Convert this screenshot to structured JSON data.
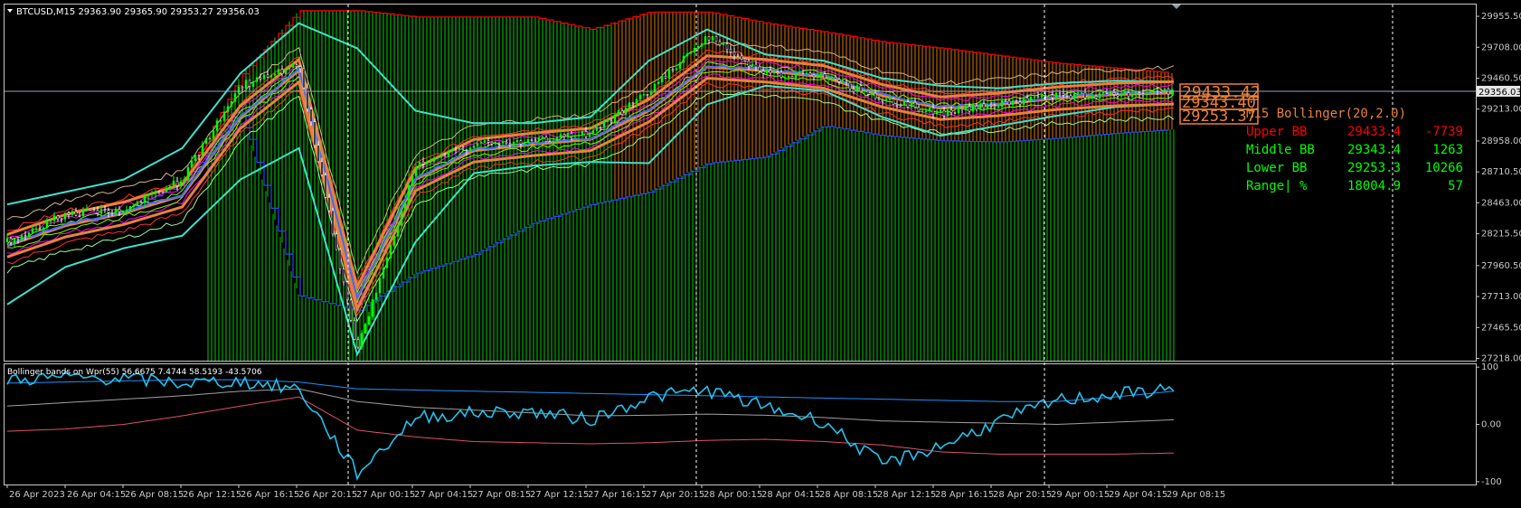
{
  "header": {
    "symbol_line": "BTCUSD,M15  29363.90 29365.90 29353.27 29356.03"
  },
  "current_price_label": "29356.03",
  "bb_panel": {
    "title": "M15 Bollinger(20,2.0)",
    "rows": [
      {
        "label": "Upper BB",
        "value": "29433.4",
        "extra": "-7739",
        "color": "#ff0000"
      },
      {
        "label": "Middle BB",
        "value": "29343.4",
        "extra": "1263",
        "color": "#00ff00"
      },
      {
        "label": "Lower BB",
        "value": "29253.3",
        "extra": "10266",
        "color": "#00ff00"
      },
      {
        "label": "Range| %",
        "value": "18004.9",
        "extra": "57",
        "color": "#00ff00"
      }
    ]
  },
  "price_tags": [
    "29433.42",
    "29343.40",
    "29253.37"
  ],
  "indicator_title": "Bollinger bands on Wpr(55) 56.6675 7.4744 58.5193 -43.5706",
  "colors": {
    "background": "#000000",
    "bull": "#00ff00",
    "bear": "#ff8c00",
    "cloud_edge": "#ff0000",
    "bb_orange": "#e8823a",
    "cyan": "#40e0d0",
    "wpr_line": "#22c3ee",
    "axis": "#c8c8c8"
  },
  "chart_data": [
    {
      "type": "line",
      "name": "price",
      "x": [
        "26 Apr 2023",
        "26 Apr 04:15",
        "26 Apr 08:15",
        "26 Apr 12:15",
        "26 Apr 16:15",
        "26 Apr 20:15",
        "27 Apr 00:15",
        "27 Apr 04:15",
        "27 Apr 08:15",
        "27 Apr 12:15",
        "27 Apr 16:15",
        "27 Apr 20:15",
        "28 Apr 00:15",
        "28 Apr 04:15",
        "28 Apr 08:15",
        "28 Apr 12:15",
        "28 Apr 16:15",
        "28 Apr 20:15",
        "29 Apr 00:15",
        "29 Apr 04:15",
        "29 Apr 08:15"
      ],
      "y_ticks": [
        29955.5,
        29708.0,
        29460.5,
        29213.0,
        28958.0,
        28710.5,
        28463.0,
        28215.5,
        27960.5,
        27713.0,
        27465.5,
        27218.0
      ],
      "ylim": [
        27200,
        30050
      ],
      "price_series": [
        28150,
        28380,
        28400,
        28650,
        29400,
        29560,
        27280,
        28750,
        28930,
        28950,
        29020,
        29350,
        29800,
        29500,
        29470,
        29300,
        29180,
        29250,
        29320,
        29330,
        29356
      ],
      "middle_bb": [
        28120,
        28280,
        28380,
        28520,
        29150,
        29520,
        27700,
        28650,
        28880,
        28930,
        28970,
        29200,
        29550,
        29520,
        29470,
        29320,
        29220,
        29250,
        29300,
        29330,
        29343
      ],
      "upper_bb": [
        28450,
        28550,
        28650,
        28900,
        29500,
        29900,
        29700,
        29200,
        29100,
        29100,
        29150,
        29600,
        29850,
        29650,
        29600,
        29460,
        29400,
        29380,
        29420,
        29440,
        29433
      ],
      "lower_bb": [
        27650,
        27950,
        28100,
        28200,
        28650,
        28900,
        27250,
        28150,
        28700,
        28760,
        28790,
        28780,
        29250,
        29400,
        29360,
        29150,
        29000,
        29080,
        29160,
        29230,
        29253
      ],
      "cloud_top": [
        28080,
        28250,
        28400,
        28620,
        29480,
        30000,
        30000,
        29950,
        29950,
        29950,
        29850,
        29990,
        29990,
        29900,
        29830,
        29750,
        29700,
        29640,
        29580,
        29540,
        29500
      ],
      "cloud_bottom": [
        28080,
        28250,
        28400,
        28620,
        29200,
        27720,
        27600,
        27900,
        28050,
        28300,
        28450,
        28550,
        28780,
        28830,
        29080,
        29000,
        28960,
        28950,
        28980,
        29020,
        29050
      ]
    },
    {
      "type": "line",
      "name": "wpr",
      "ylim": [
        -105,
        105
      ],
      "y_ticks": [
        100,
        0.0,
        -100
      ],
      "wpr": [
        78,
        82,
        80,
        72,
        75,
        62,
        -85,
        12,
        20,
        22,
        8,
        48,
        60,
        30,
        5,
        -70,
        -38,
        5,
        42,
        52,
        62
      ],
      "wpr_upper": [
        72,
        74,
        76,
        78,
        78,
        74,
        62,
        60,
        58,
        56,
        54,
        52,
        50,
        48,
        46,
        44,
        42,
        40,
        40,
        48,
        58
      ],
      "wpr_middle": [
        32,
        38,
        44,
        50,
        58,
        62,
        40,
        30,
        25,
        20,
        15,
        16,
        18,
        16,
        12,
        6,
        4,
        2,
        0,
        4,
        8
      ],
      "wpr_lower": [
        -12,
        -8,
        0,
        15,
        32,
        48,
        -10,
        -22,
        -30,
        -32,
        -34,
        -32,
        -28,
        -26,
        -30,
        -36,
        -48,
        -52,
        -52,
        -52,
        -50
      ]
    }
  ]
}
